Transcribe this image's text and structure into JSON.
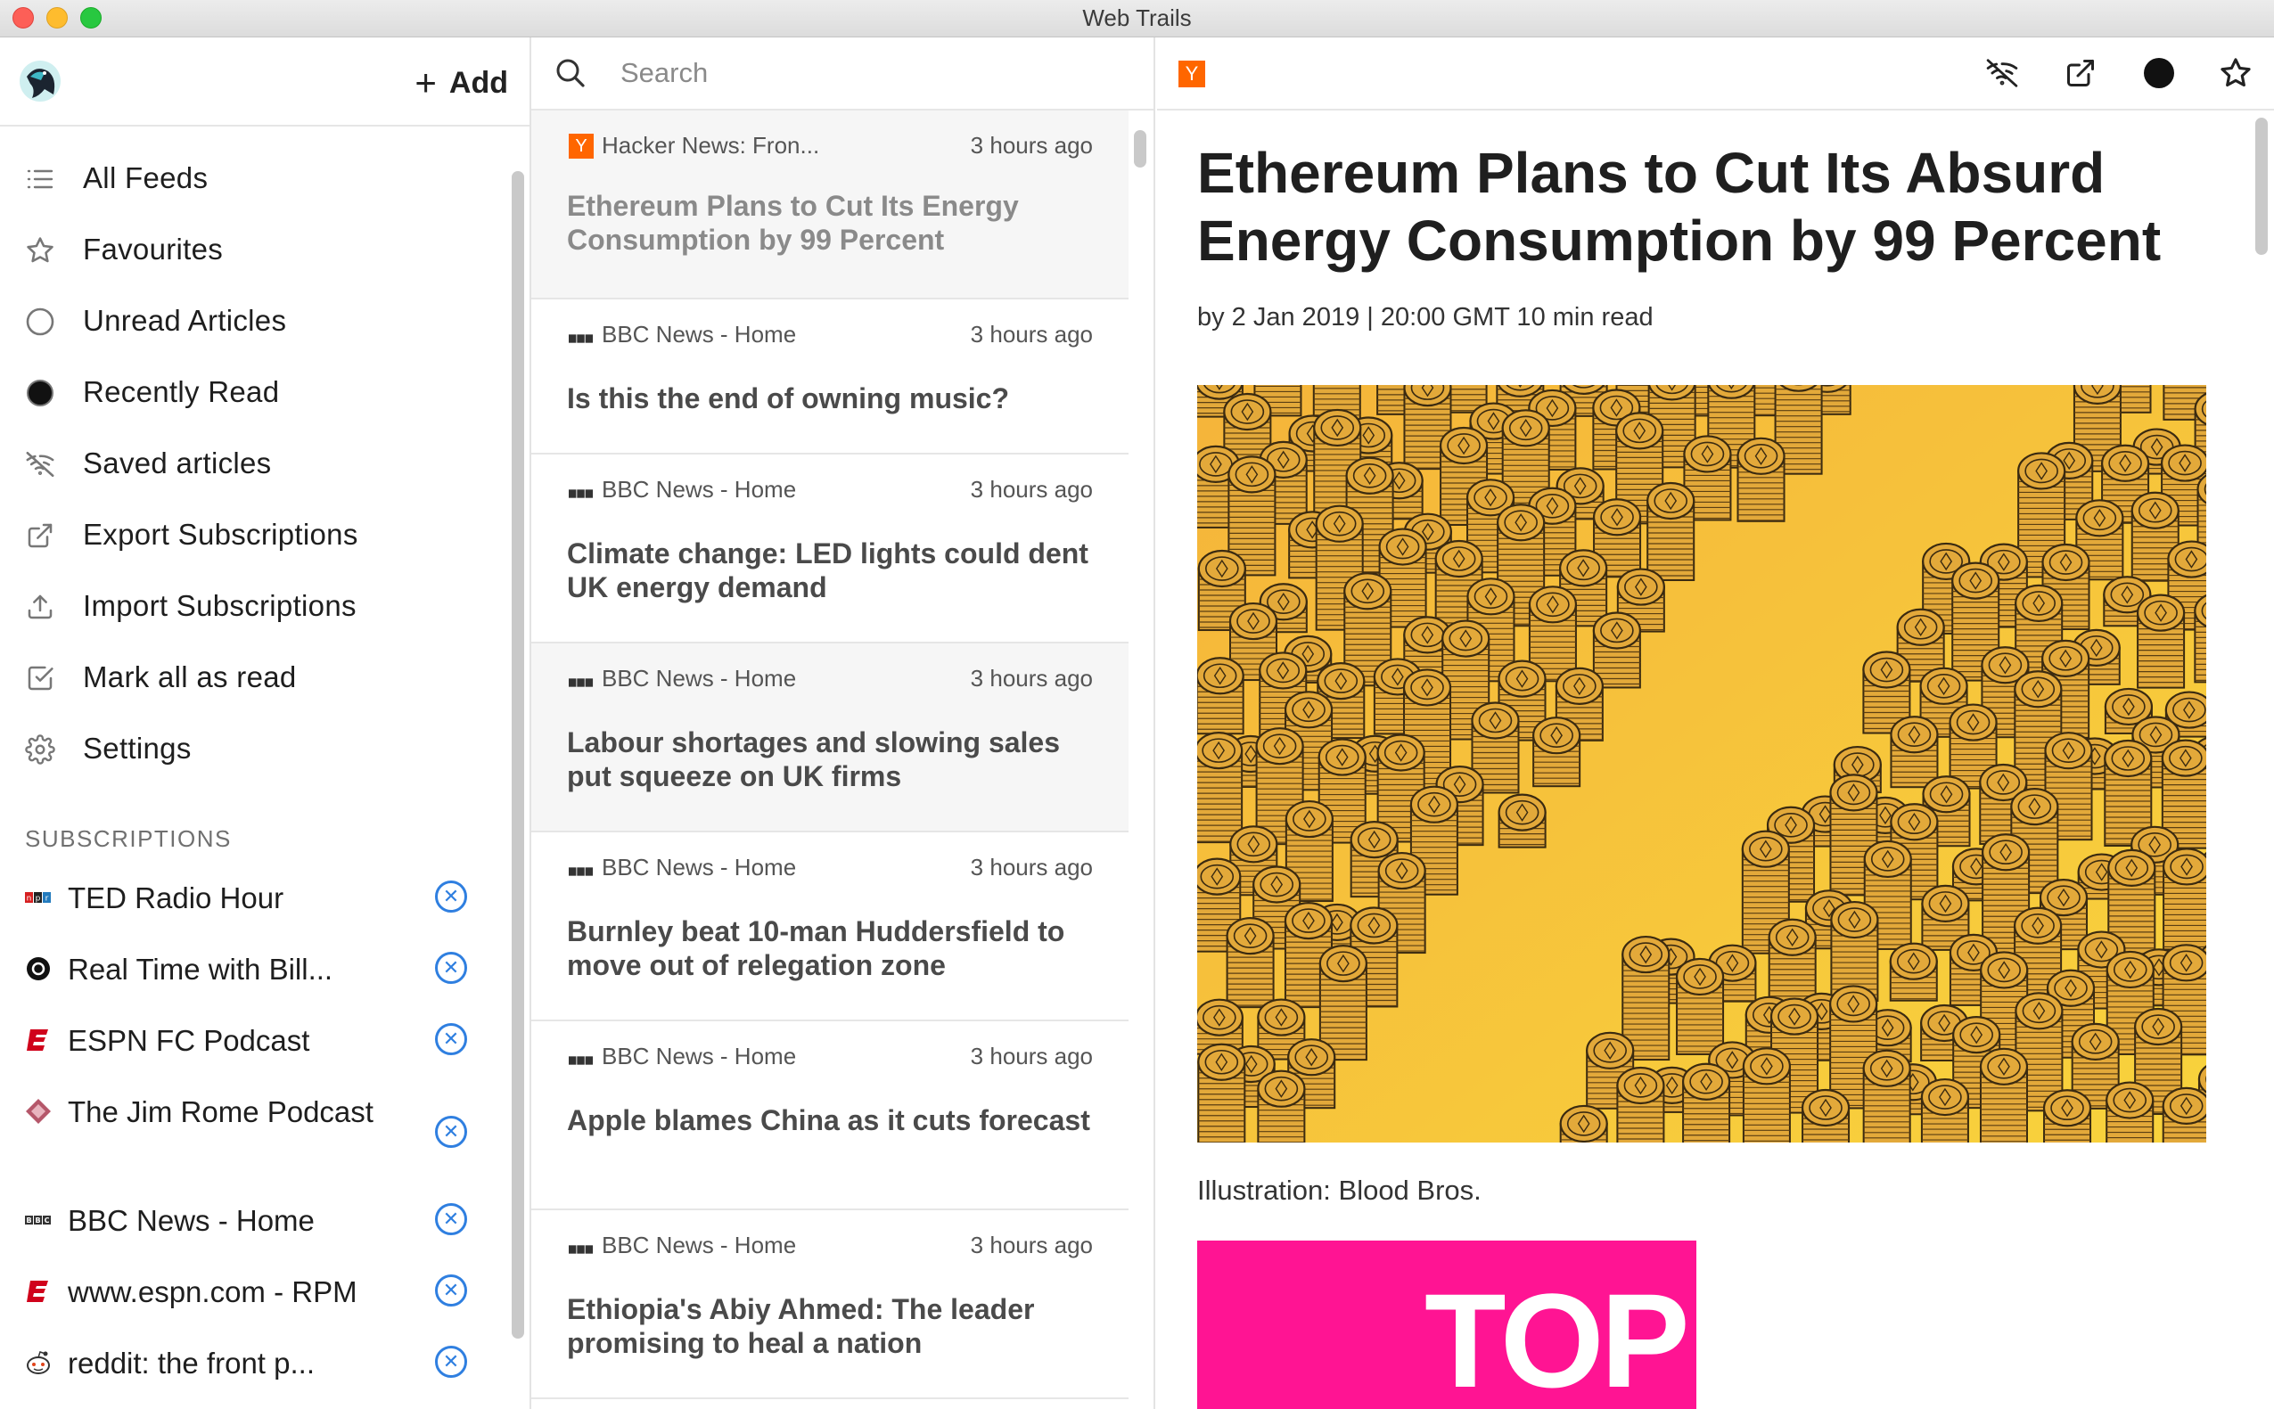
{
  "window": {
    "title": "Web Trails"
  },
  "sidebar": {
    "add_label": "Add",
    "nav": [
      {
        "label": "All Feeds",
        "icon": "list-icon"
      },
      {
        "label": "Favourites",
        "icon": "star-icon"
      },
      {
        "label": "Unread Articles",
        "icon": "circle-outline-icon"
      },
      {
        "label": "Recently Read",
        "icon": "filled-circle-icon"
      },
      {
        "label": "Saved articles",
        "icon": "offline-wifi-icon"
      },
      {
        "label": "Export Subscriptions",
        "icon": "external-link-icon"
      },
      {
        "label": "Import Subscriptions",
        "icon": "upload-icon"
      },
      {
        "label": "Mark all as read",
        "icon": "checkbox-icon"
      },
      {
        "label": "Settings",
        "icon": "gear-icon"
      }
    ],
    "subscriptions_title": "SUBSCRIPTIONS",
    "subscriptions": [
      {
        "name": "TED Radio Hour",
        "icon": "npr-icon"
      },
      {
        "name": "Real Time with Bill...",
        "icon": "hbo-icon"
      },
      {
        "name": "ESPN FC Podcast",
        "icon": "espn-icon"
      },
      {
        "name": "The Jim Rome Podcast",
        "icon": "jimrome-icon"
      },
      {
        "name": "BBC News - Home",
        "icon": "bbc-icon"
      },
      {
        "name": "www.espn.com - RPM",
        "icon": "espn-icon"
      },
      {
        "name": "reddit: the front p...",
        "icon": "reddit-icon"
      }
    ]
  },
  "list": {
    "search_placeholder": "Search",
    "articles": [
      {
        "source": "Hacker News: Fron...",
        "time": "3 hours ago",
        "title": "Ethereum Plans to Cut Its Energy Consumption by 99 Percent",
        "favicon": "hackernews-icon"
      },
      {
        "source": "BBC News - Home",
        "time": "3 hours ago",
        "title": "Is this the end of owning music?",
        "favicon": "bbc-icon"
      },
      {
        "source": "BBC News - Home",
        "time": "3 hours ago",
        "title": "Climate change: LED lights could dent UK energy demand",
        "favicon": "bbc-icon"
      },
      {
        "source": "BBC News - Home",
        "time": "3 hours ago",
        "title": "Labour shortages and slowing sales put squeeze on UK firms",
        "favicon": "bbc-icon"
      },
      {
        "source": "BBC News - Home",
        "time": "3 hours ago",
        "title": "Burnley beat 10-man Huddersfield to move out of relegation zone",
        "favicon": "bbc-icon"
      },
      {
        "source": "BBC News - Home",
        "time": "3 hours ago",
        "title": "Apple blames China as it cuts forecast",
        "favicon": "bbc-icon"
      },
      {
        "source": "BBC News - Home",
        "time": "3 hours ago",
        "title": "Ethiopia's Abiy Ahmed: The leader promising to heal a nation",
        "favicon": "bbc-icon"
      }
    ]
  },
  "reader": {
    "favicon_letter": "Y",
    "title": "Ethereum Plans to Cut Its Absurd Energy Consumption by 99 Percent",
    "meta": "by 2 Jan 2019 | 20:00 GMT 10 min read",
    "caption": "Illustration: Blood Bros.",
    "second_image_text": "TOP",
    "toolbar_icons": [
      "offline-wifi-icon",
      "external-link-icon",
      "filled-circle-icon",
      "star-icon"
    ]
  },
  "colors": {
    "accent": "#2f7fe0",
    "hackernews": "#ff6600",
    "coin": "#e3a93a",
    "image_bg": "#f7c22e",
    "pink": "#ff1493"
  }
}
